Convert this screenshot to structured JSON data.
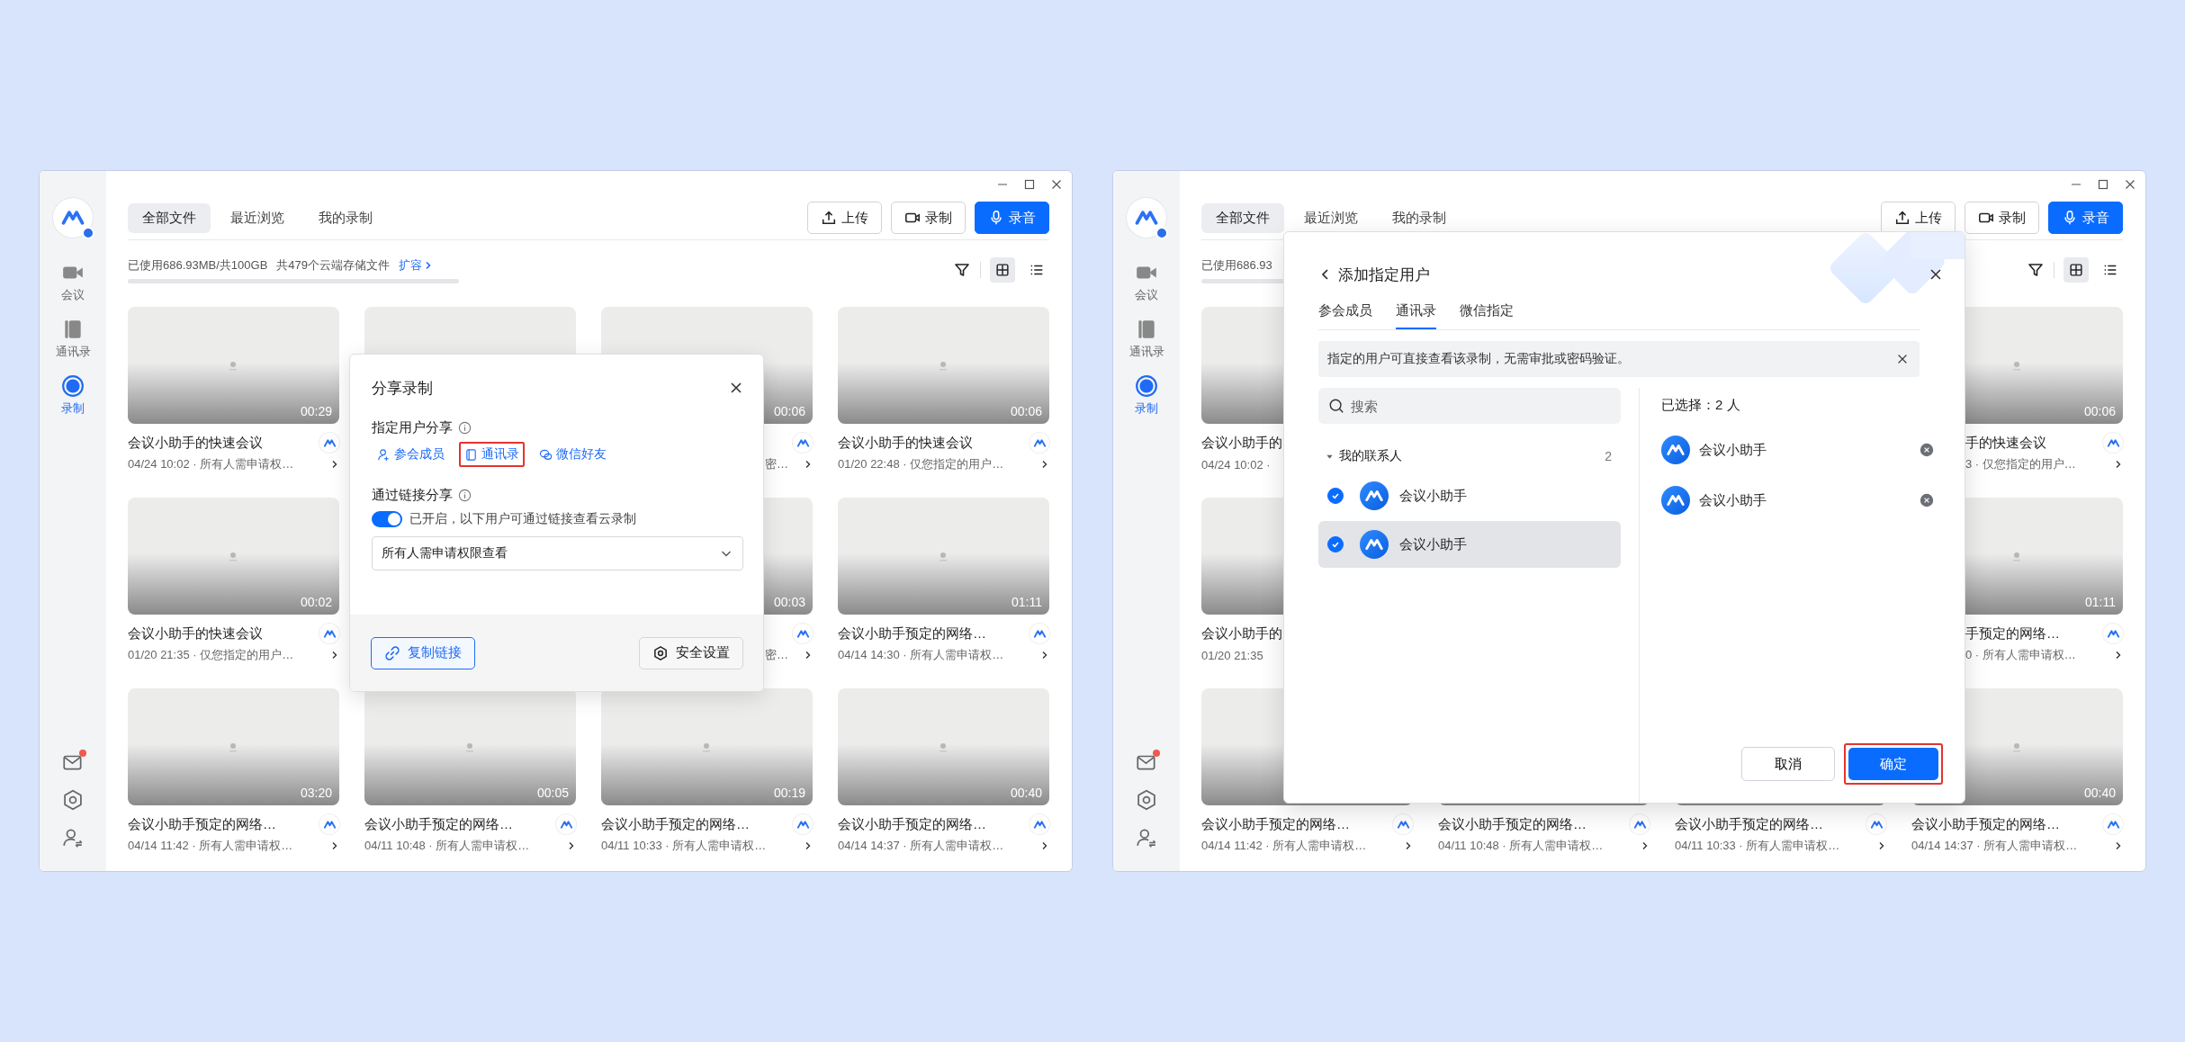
{
  "windows": [
    {
      "sidebar": {
        "items": [
          {
            "label": "会议",
            "kind": "video",
            "selected": false
          },
          {
            "label": "通讯录",
            "kind": "contacts",
            "selected": false
          },
          {
            "label": "录制",
            "kind": "record",
            "selected": true
          }
        ],
        "bottom": [
          {
            "kind": "mail",
            "unread": true
          },
          {
            "kind": "settings"
          },
          {
            "kind": "account"
          }
        ]
      },
      "tabs": [
        {
          "label": "全部文件",
          "selected": true
        },
        {
          "label": "最近浏览",
          "selected": false
        },
        {
          "label": "我的录制",
          "selected": false
        }
      ],
      "actions": [
        {
          "label": "上传",
          "kind": "upload",
          "primary": false
        },
        {
          "label": "录制",
          "kind": "camera",
          "primary": false
        },
        {
          "label": "录音",
          "kind": "mic",
          "primary": true
        }
      ],
      "storage": {
        "used": "已使用686.93MB/共100GB",
        "files": "共479个云端存储文件",
        "link": "扩容"
      },
      "views": [
        {
          "kind": "grid",
          "selected": true
        },
        {
          "kind": "list",
          "selected": false
        }
      ],
      "cards": [
        {
          "title": "会议小助手的快速会议",
          "meta": "04/24 10:02 · 所有人需申请权…",
          "duration": "00:29",
          "kind": "full"
        },
        {
          "kind": "thumb"
        },
        {
          "meta": "密…",
          "duration": "00:06",
          "kind": "tail"
        },
        {
          "title": "会议小助手的快速会议",
          "meta": "01/20 22:48 · 仅您指定的用户…",
          "duration": "00:06",
          "kind": "full"
        },
        {
          "title": "会议小助手的快速会议",
          "meta": "01/20 21:35 · 仅您指定的用户…",
          "duration": "00:02",
          "kind": "full"
        },
        {
          "kind": "covered"
        },
        {
          "meta": "密…",
          "duration": "00:03",
          "kind": "tail"
        },
        {
          "title": "会议小助手预定的网络…",
          "meta": "04/14 14:30 · 所有人需申请权…",
          "duration": "01:11",
          "kind": "full"
        },
        {
          "title": "会议小助手预定的网络…",
          "meta": "04/14 11:42 · 所有人需申请权…",
          "duration": "03:20",
          "kind": "full"
        },
        {
          "title": "会议小助手预定的网络…",
          "meta": "04/11 10:48 · 所有人需申请权…",
          "duration": "00:05",
          "kind": "full"
        },
        {
          "title": "会议小助手预定的网络…",
          "meta": "04/11 10:33 · 所有人需申请权…",
          "duration": "00:19",
          "kind": "full"
        },
        {
          "title": "会议小助手预定的网络…",
          "meta": "04/14 14:37 · 所有人需申请权…",
          "duration": "00:40",
          "kind": "full"
        }
      ],
      "share_popup": {
        "title": "分享录制",
        "user_share": {
          "label": "指定用户分享",
          "options": [
            {
              "label": "参会成员",
              "kind": "member",
              "highlighted": false
            },
            {
              "label": "通讯录",
              "kind": "contacts",
              "highlighted": true
            },
            {
              "label": "微信好友",
              "kind": "wechat",
              "highlighted": false
            }
          ]
        },
        "link_share": {
          "label": "通过链接分享",
          "on": true,
          "status": "已开启，以下用户可通过链接查看云录制",
          "permission": "所有人需申请权限查看"
        },
        "copy_button": "复制链接",
        "security_button": "安全设置"
      }
    },
    {
      "sidebar": {
        "items": [
          {
            "label": "会议",
            "kind": "video",
            "selected": false
          },
          {
            "label": "通讯录",
            "kind": "contacts",
            "selected": false
          },
          {
            "label": "录制",
            "kind": "record",
            "selected": true
          }
        ],
        "bottom": [
          {
            "kind": "mail",
            "unread": true
          },
          {
            "kind": "settings"
          },
          {
            "kind": "account"
          }
        ]
      },
      "tabs": [
        {
          "label": "全部文件",
          "selected": true
        },
        {
          "label": "最近浏览",
          "selected": false
        },
        {
          "label": "我的录制",
          "selected": false
        }
      ],
      "actions": [
        {
          "label": "上传",
          "kind": "upload",
          "primary": false
        },
        {
          "label": "录制",
          "kind": "camera",
          "primary": false
        },
        {
          "label": "录音",
          "kind": "mic",
          "primary": true
        }
      ],
      "storage": {
        "used": "已使用686.93"
      },
      "views": [
        {
          "kind": "grid",
          "selected": true
        },
        {
          "kind": "list",
          "selected": false
        }
      ],
      "cards": [
        {
          "title": "会议小助手的",
          "meta": "04/24 10:02 ·",
          "kind": "head"
        },
        {
          "kind": "covered"
        },
        {
          "kind": "covered"
        },
        {
          "title": "手的快速会议",
          "meta": "3 · 仅您指定的用户…",
          "duration": "00:06",
          "kind": "tail"
        },
        {
          "title": "会议小助手的",
          "meta": "01/20 21:35",
          "kind": "head"
        },
        {
          "kind": "covered"
        },
        {
          "kind": "covered"
        },
        {
          "title": "手预定的网络…",
          "meta": "0 · 所有人需申请权…",
          "duration": "01:11",
          "kind": "tail"
        },
        {
          "title": "会议小助手预定的网络…",
          "meta": "04/14 11:42 · 所有人需申请权…",
          "kind": "full"
        },
        {
          "title": "会议小助手预定的网络…",
          "meta": "04/11 10:48 · 所有人需申请权…",
          "kind": "full"
        },
        {
          "title": "会议小助手预定的网络…",
          "meta": "04/11 10:33 · 所有人需申请权…",
          "kind": "full"
        },
        {
          "title": "会议小助手预定的网络…",
          "meta": "04/14 14:37 · 所有人需申请权…",
          "duration": "00:40",
          "kind": "full"
        }
      ],
      "add_user_dialog": {
        "title": "添加指定用户",
        "tabs": [
          {
            "label": "参会成员",
            "selected": false
          },
          {
            "label": "通讯录",
            "selected": true
          },
          {
            "label": "微信指定",
            "selected": false
          }
        ],
        "notice": "指定的用户可直接查看该录制，无需审批或密码验证。",
        "search": {
          "placeholder": "搜索"
        },
        "groups": [
          {
            "label": "我的联系人",
            "count": "2",
            "expanded": true,
            "children": [
              {
                "name": "会议小助手",
                "checked": true,
                "selected": false
              },
              {
                "name": "会议小助手",
                "checked": true,
                "selected": true
              }
            ]
          }
        ],
        "selected_label": "已选择：2 人",
        "selected_users": [
          "会议小助手",
          "会议小助手"
        ],
        "cancel_button": "取消",
        "confirm_button": {
          "label": "确定",
          "highlighted": true
        }
      }
    }
  ]
}
